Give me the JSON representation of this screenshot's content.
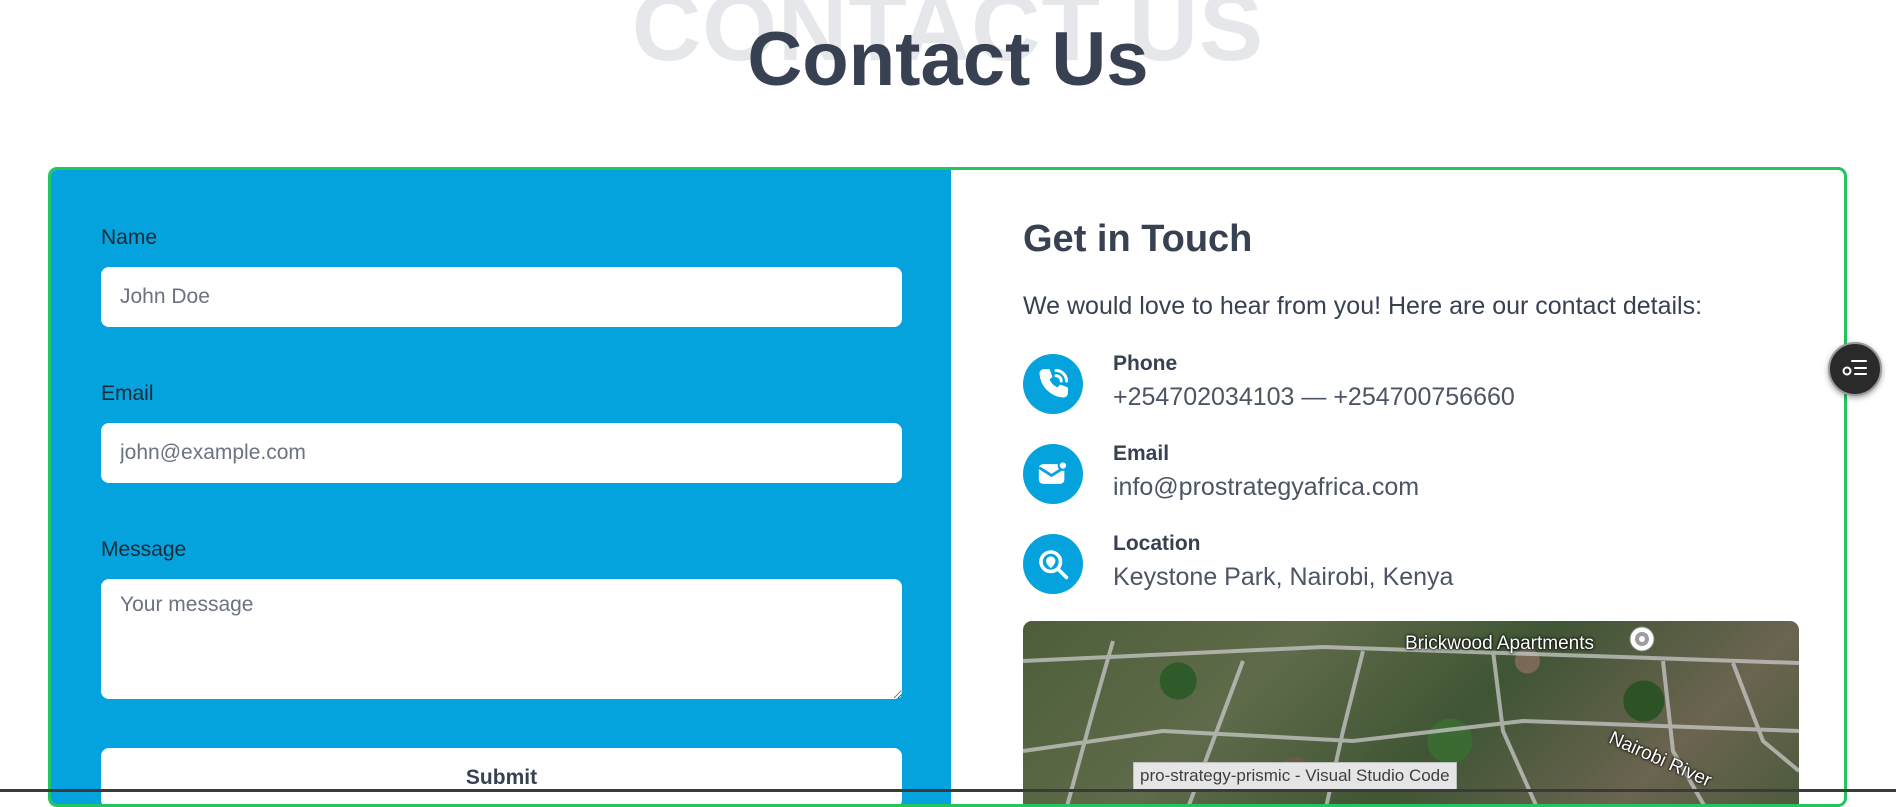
{
  "page": {
    "background_title": "CONTACT US",
    "title": "Contact Us"
  },
  "form": {
    "name_label": "Name",
    "name_placeholder": "John Doe",
    "email_label": "Email",
    "email_placeholder": "john@example.com",
    "message_label": "Message",
    "message_placeholder": "Your message",
    "submit_label": "Submit"
  },
  "info": {
    "title": "Get in Touch",
    "intro": "We would love to hear from you! Here are our contact details:",
    "items": [
      {
        "label": "Phone",
        "value": "+254702034103 — +254700756660",
        "icon": "phone-icon"
      },
      {
        "label": "Email",
        "value": "info@prostrategyafrica.com",
        "icon": "mail-icon"
      },
      {
        "label": "Location",
        "value": "Keystone Park, Nairobi, Kenya",
        "icon": "location-search-icon"
      }
    ]
  },
  "map": {
    "place_label": "Brickwood Apartments",
    "river_label": "Nairobi River"
  },
  "taskbar_tooltip": "pro-strategy-prismic - Visual Studio Code",
  "colors": {
    "brand_blue": "#04a3dd",
    "card_border": "#22c55e",
    "heading": "#374151"
  }
}
